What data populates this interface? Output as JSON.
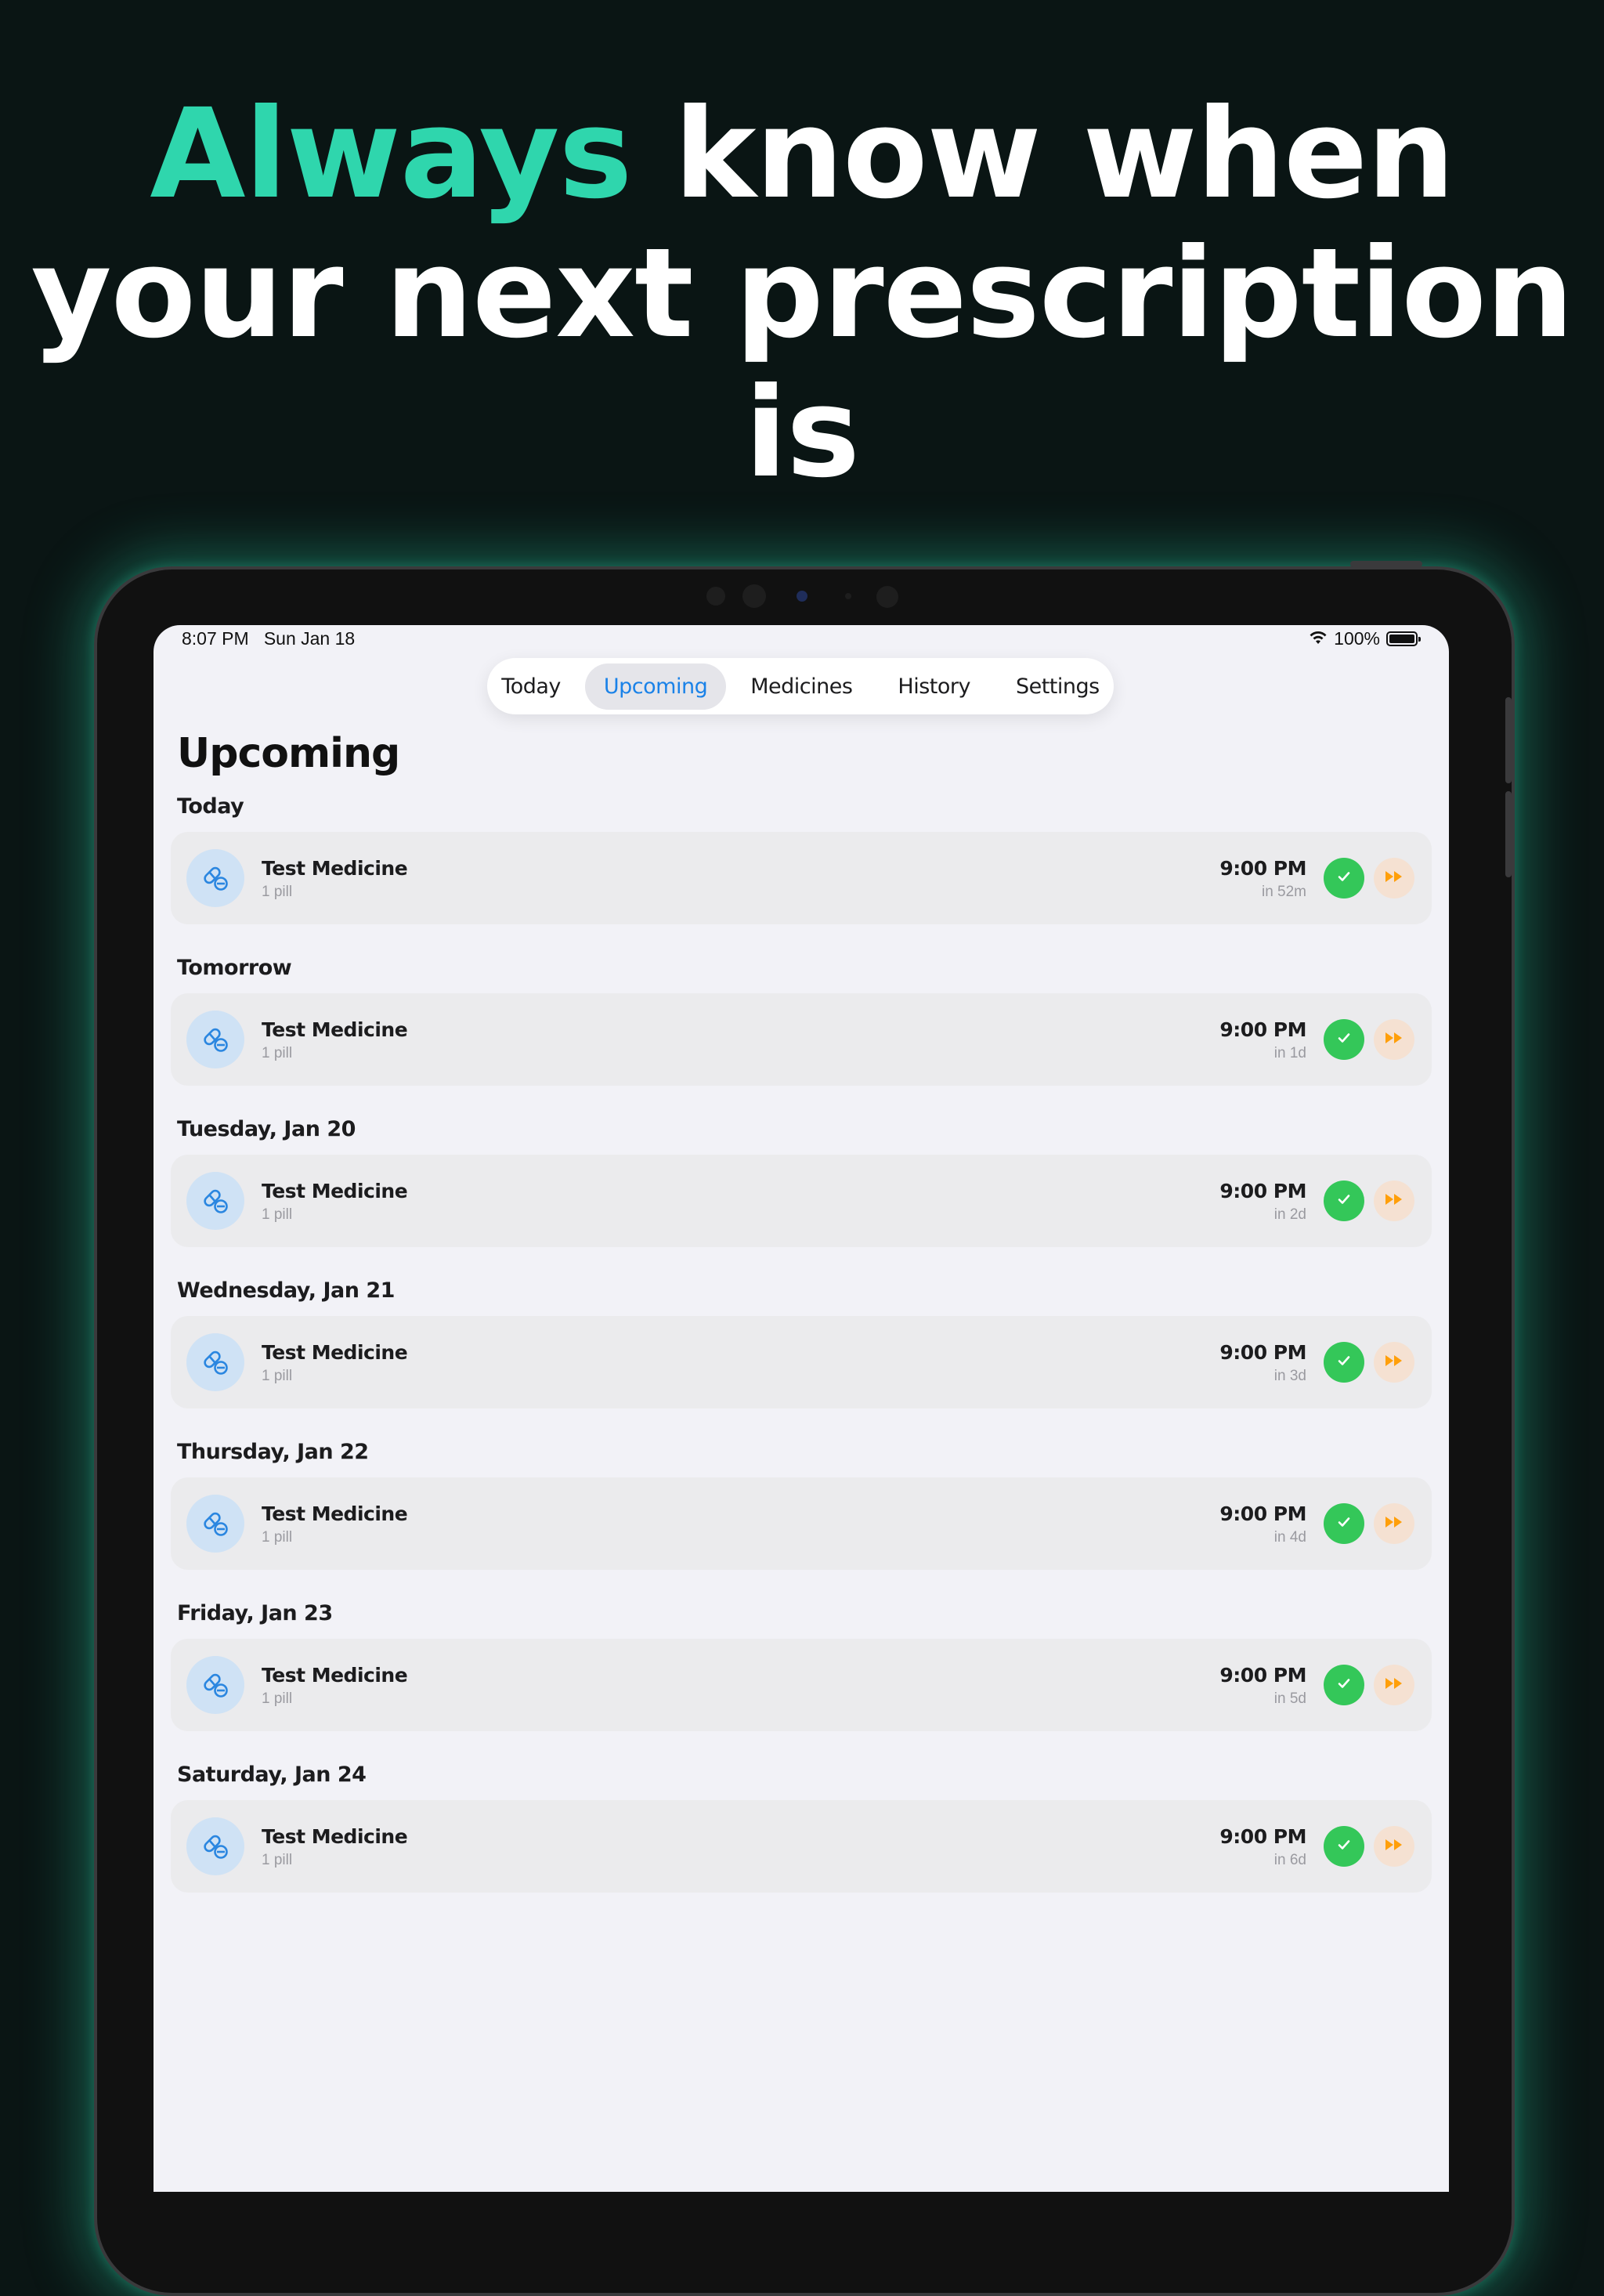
{
  "headline": {
    "accent_word": "Always",
    "rest_line1": "know when",
    "line2": "your next prescription",
    "line3": "is"
  },
  "colors": {
    "accent": "#2fd6ad",
    "tab_active": "#1a82e8",
    "take_button": "#34c759",
    "skip_button": "#ff9f0a"
  },
  "status_bar": {
    "time": "8:07 PM",
    "date": "Sun Jan 18",
    "battery": "100%",
    "wifi_icon": "wifi-icon",
    "battery_icon": "battery-icon"
  },
  "tabs": [
    {
      "label": "Today",
      "active": false
    },
    {
      "label": "Upcoming",
      "active": true
    },
    {
      "label": "Medicines",
      "active": false
    },
    {
      "label": "History",
      "active": false
    },
    {
      "label": "Settings",
      "active": false
    }
  ],
  "page_title": "Upcoming",
  "sections": [
    {
      "header": "Today",
      "items": [
        {
          "name": "Test Medicine",
          "dose": "1 pill",
          "time": "9:00 PM",
          "relative": "in 52m"
        }
      ]
    },
    {
      "header": "Tomorrow",
      "items": [
        {
          "name": "Test Medicine",
          "dose": "1 pill",
          "time": "9:00 PM",
          "relative": "in 1d"
        }
      ]
    },
    {
      "header": "Tuesday, Jan 20",
      "items": [
        {
          "name": "Test Medicine",
          "dose": "1 pill",
          "time": "9:00 PM",
          "relative": "in 2d"
        }
      ]
    },
    {
      "header": "Wednesday, Jan 21",
      "items": [
        {
          "name": "Test Medicine",
          "dose": "1 pill",
          "time": "9:00 PM",
          "relative": "in 3d"
        }
      ]
    },
    {
      "header": "Thursday, Jan 22",
      "items": [
        {
          "name": "Test Medicine",
          "dose": "1 pill",
          "time": "9:00 PM",
          "relative": "in 4d"
        }
      ]
    },
    {
      "header": "Friday, Jan 23",
      "items": [
        {
          "name": "Test Medicine",
          "dose": "1 pill",
          "time": "9:00 PM",
          "relative": "in 5d"
        }
      ]
    },
    {
      "header": "Saturday, Jan 24",
      "items": [
        {
          "name": "Test Medicine",
          "dose": "1 pill",
          "time": "9:00 PM",
          "relative": "in 6d"
        }
      ]
    }
  ],
  "icons": {
    "medicine": "pill-icon",
    "take": "checkmark-icon",
    "skip": "skip-forward-icon"
  }
}
